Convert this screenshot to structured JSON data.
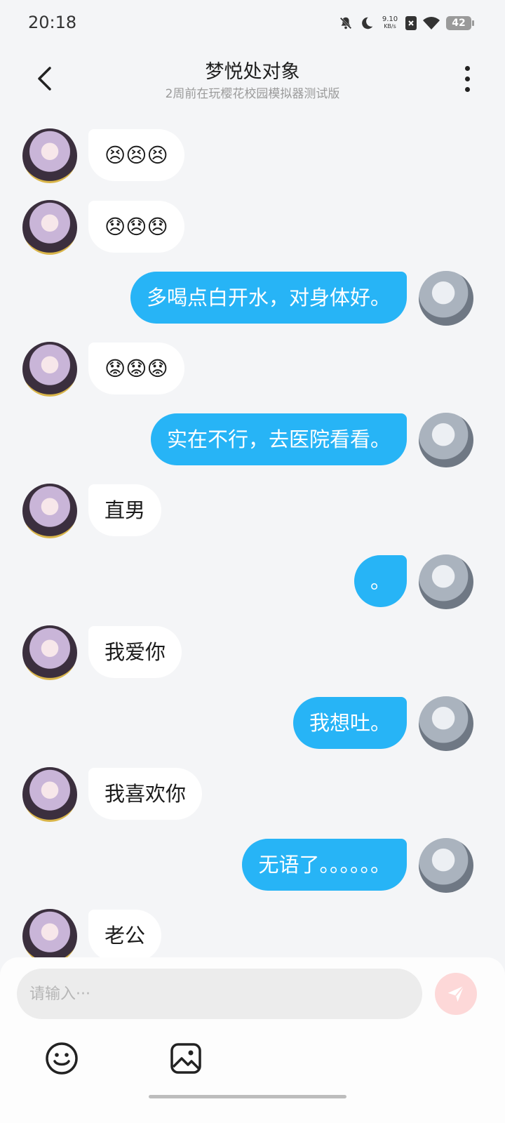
{
  "status_bar": {
    "time": "20:18",
    "net_speed_value": "9.10",
    "net_speed_unit": "KB/s",
    "battery": "42",
    "icons": [
      "bell-off-icon",
      "moon-icon",
      "net-speed",
      "sim-x-icon",
      "wifi-icon",
      "battery-icon"
    ]
  },
  "header": {
    "title": "梦悦处对象",
    "subtitle": "2周前在玩樱花校园模拟器测试版",
    "back_icon": "chevron-left-icon",
    "more_icon": "more-vertical-icon"
  },
  "messages": [
    {
      "sender": "other",
      "text": "😣😣😣"
    },
    {
      "sender": "other",
      "text": "😞😞😞"
    },
    {
      "sender": "me",
      "text": "多喝点白开水，对身体好。"
    },
    {
      "sender": "other",
      "text": "😟😟😟"
    },
    {
      "sender": "me",
      "text": "实在不行，去医院看看。"
    },
    {
      "sender": "other",
      "text": "直男"
    },
    {
      "sender": "me",
      "text": "。"
    },
    {
      "sender": "other",
      "text": "我爱你"
    },
    {
      "sender": "me",
      "text": "我想吐。"
    },
    {
      "sender": "other",
      "text": "我喜欢你"
    },
    {
      "sender": "me",
      "text": "无语了。。。。。。"
    },
    {
      "sender": "other",
      "text": "老公"
    }
  ],
  "input": {
    "placeholder": "请输入···",
    "value": ""
  },
  "toolbar": {
    "send_icon": "send-icon",
    "emoji_icon": "emoji-smile-icon",
    "image_icon": "image-icon"
  },
  "colors": {
    "my_bubble": "#27b4f6",
    "other_bubble": "#ffffff",
    "background": "#f4f5f7",
    "send_button": "#fdd8d8"
  }
}
